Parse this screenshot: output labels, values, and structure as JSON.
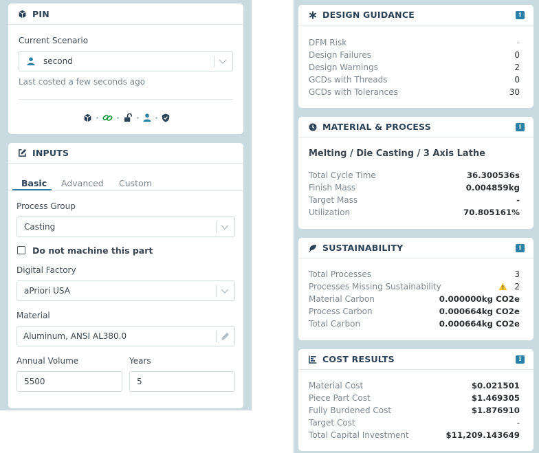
{
  "pin": {
    "title": "PIN",
    "scenario_label": "Current Scenario",
    "scenario_value": "second",
    "last_costed": "Last costed a few seconds ago"
  },
  "inputs": {
    "title": "INPUTS",
    "tabs": [
      "Basic",
      "Advanced",
      "Custom"
    ],
    "process_group_label": "Process Group",
    "process_group_value": "Casting",
    "do_not_machine_label": "Do not machine this part",
    "digital_factory_label": "Digital Factory",
    "digital_factory_value": "aPriori USA",
    "material_label": "Material",
    "material_value": "Aluminum, ANSI AL380.0",
    "annual_volume_label": "Annual Volume",
    "annual_volume_value": "5500",
    "years_label": "Years",
    "years_value": "5"
  },
  "design_guidance": {
    "title": "DESIGN GUIDANCE",
    "rows": [
      {
        "label": "DFM Risk",
        "value": "-"
      },
      {
        "label": "Design Failures",
        "value": "0"
      },
      {
        "label": "Design Warnings",
        "value": "2"
      },
      {
        "label": "GCDs with Threads",
        "value": "0"
      },
      {
        "label": "GCDs with Tolerances",
        "value": "30"
      }
    ]
  },
  "material_process": {
    "title": "MATERIAL & PROCESS",
    "heading": "Melting / Die Casting / 3 Axis Lathe",
    "rows": [
      {
        "label": "Total Cycle Time",
        "value": "36.300536s"
      },
      {
        "label": "Finish Mass",
        "value": "0.004859kg"
      },
      {
        "label": "Target Mass",
        "value": "-"
      },
      {
        "label": "Utilization",
        "value": "70.805161%"
      }
    ]
  },
  "sustainability": {
    "title": "SUSTAINABILITY",
    "rows": [
      {
        "label": "Total Processes",
        "value": "3"
      },
      {
        "label": "Processes Missing Sustainability",
        "value": "2"
      },
      {
        "label": "Material Carbon",
        "value": "0.000000kg CO2e"
      },
      {
        "label": "Process Carbon",
        "value": "0.000664kg CO2e"
      },
      {
        "label": "Total Carbon",
        "value": "0.000664kg CO2e"
      }
    ]
  },
  "cost_results": {
    "title": "COST RESULTS",
    "rows": [
      {
        "label": "Material Cost",
        "value": "$0.021501"
      },
      {
        "label": "Piece Part Cost",
        "value": "$1.469305"
      },
      {
        "label": "Fully Burdened Cost",
        "value": "$1.876910"
      },
      {
        "label": "Target Cost",
        "value": "-"
      },
      {
        "label": "Total Capital Investment",
        "value": "$11,209.143649"
      }
    ]
  },
  "colors": {
    "background": "#c9dbe1",
    "accent": "#2a7fa6",
    "link_green": "#1a9c3e",
    "warning": "#f3c12b"
  }
}
